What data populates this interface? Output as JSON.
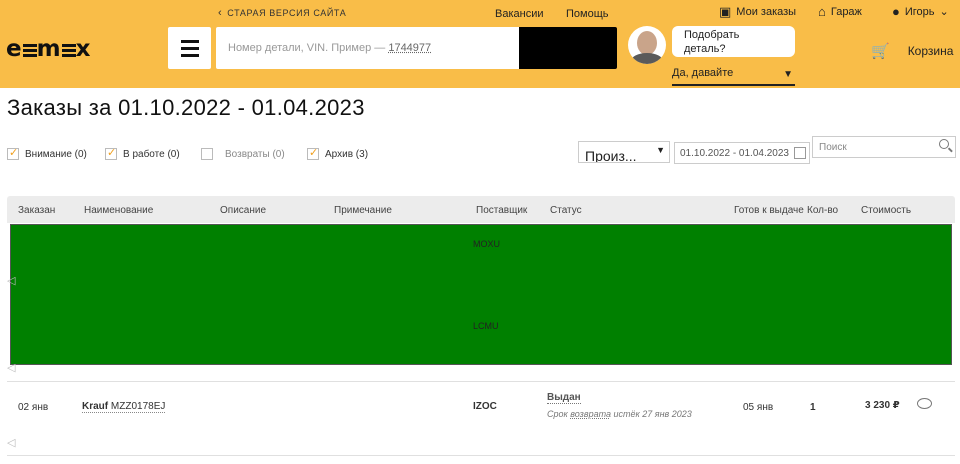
{
  "header": {
    "old_site": "СТАРАЯ ВЕРСИЯ САЙТА",
    "vacancies": "Вакансии",
    "help": "Помощь",
    "my_orders": "Мои заказы",
    "garage": "Гараж",
    "user": "Игорь",
    "logo": "emex",
    "search_placeholder": "Номер детали, VIN. Пример — ",
    "search_example": "1744977",
    "assistant_question": "Подобрать деталь?",
    "assistant_answer": "Да, давайте",
    "cart": "Корзина"
  },
  "page": {
    "title": "Заказы за 01.10.2022 - 01.04.2023",
    "filters": [
      {
        "label": "Внимание (0)",
        "checked": true
      },
      {
        "label": "В работе (0)",
        "checked": true
      },
      {
        "label": "Возвраты (0)",
        "checked": false
      },
      {
        "label": "Архив (3)",
        "checked": true
      }
    ],
    "select_value": "Произ...",
    "date_range": "01.10.2022 - 01.04.2023",
    "search_placeholder": "Поиск"
  },
  "table": {
    "headers": [
      "Заказан",
      "Наименование",
      "Описание",
      "Примечание",
      "Поставщик",
      "Статус",
      "Готов к выдаче",
      "Кол-во",
      "Стоимость"
    ],
    "redacted_suppliers": [
      "MOXU",
      "LCMU"
    ],
    "row": {
      "ordered": "02 янв",
      "brand": "Krauf",
      "part": "MZZ0178EJ",
      "supplier": "IZOC",
      "status": "Выдан",
      "return_prefix": "Срок",
      "return_link": "возврата",
      "return_suffix": "истёк 27 янв 2023",
      "ready": "05 янв",
      "qty": "1",
      "price": "3 230 ₽"
    }
  }
}
